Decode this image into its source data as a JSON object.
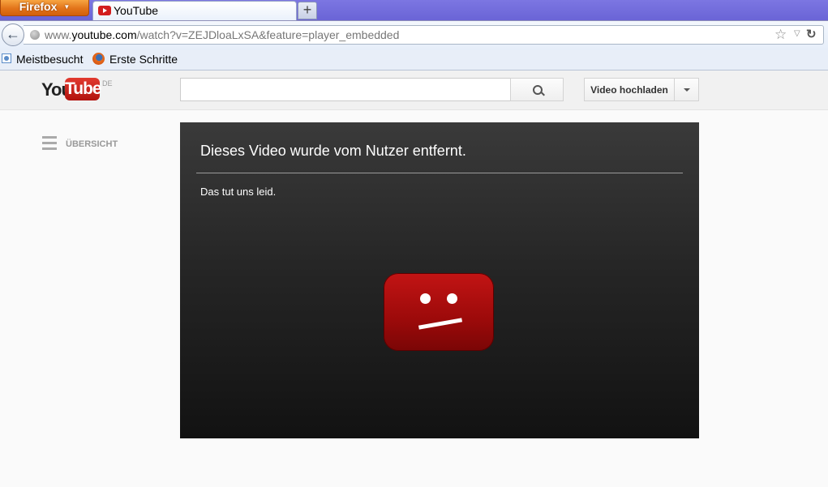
{
  "browser": {
    "menu_button": "Firefox",
    "tab_title": "YouTube",
    "new_tab_symbol": "+",
    "url_prefix": "www.",
    "url_host": "youtube.com",
    "url_path": "/watch?v=ZEJDloaLxSA&feature=player_embedded",
    "bookmarks": [
      "Meistbesucht",
      "Erste Schritte"
    ]
  },
  "header": {
    "logo_you": "You",
    "logo_tube": "Tube",
    "logo_region": "DE",
    "search_placeholder": "",
    "upload_label": "Video hochladen"
  },
  "sidebar": {
    "guide_label": "ÜBERSICHT"
  },
  "player": {
    "error_title": "Dieses Video wurde vom Nutzer entfernt.",
    "error_subtitle": "Das tut uns leid."
  },
  "colors": {
    "accent_red": "#b1120e",
    "player_bg": "#262626",
    "browser_tabstrip": "#6a64d6"
  }
}
